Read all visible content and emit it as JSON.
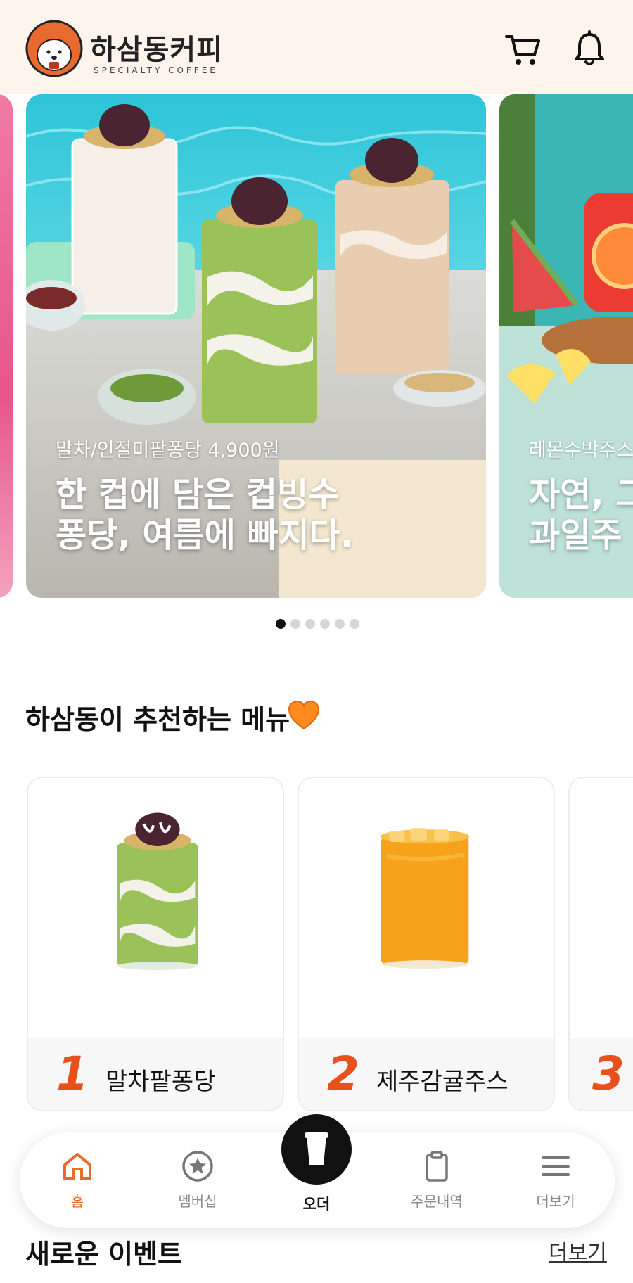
{
  "header": {
    "brand_ko": "하삼동커피",
    "brand_en": "SPECIALTY COFFEE",
    "cart_icon": "cart-icon",
    "bell_icon": "bell-icon"
  },
  "banners": [
    {
      "subtitle": "말차/인절미팥퐁당 4,900원",
      "title_line1": "한 컵에 담은 컵빙수",
      "title_line2": "퐁당, 여름에 빠지다."
    },
    {
      "subtitle": "레몬수박주스",
      "title_line1": "자연, 그",
      "title_line2": "과일주"
    }
  ],
  "carousel": {
    "total": 6,
    "active": 1
  },
  "recommended": {
    "title": "하삼동이 추천하는 메뉴",
    "heart_icon": "orange-heart-icon",
    "items": [
      {
        "rank": "1",
        "name": "말차팥퐁당"
      },
      {
        "rank": "2",
        "name": "제주감귤주스"
      },
      {
        "rank": "3",
        "name": ""
      }
    ]
  },
  "bottom_nav": {
    "items": [
      {
        "label": "홈",
        "icon": "home-icon"
      },
      {
        "label": "멤버십",
        "icon": "star-badge-icon"
      },
      {
        "label": "오더",
        "icon": "cup-icon"
      },
      {
        "label": "주문내역",
        "icon": "clipboard-icon"
      },
      {
        "label": "더보기",
        "icon": "menu-icon"
      }
    ]
  },
  "events": {
    "title": "새로운 이벤트",
    "more": "더보기"
  },
  "colors": {
    "accent": "#e96a2a",
    "rank": "#e8501c",
    "header_bg": "#fdf4ec"
  }
}
